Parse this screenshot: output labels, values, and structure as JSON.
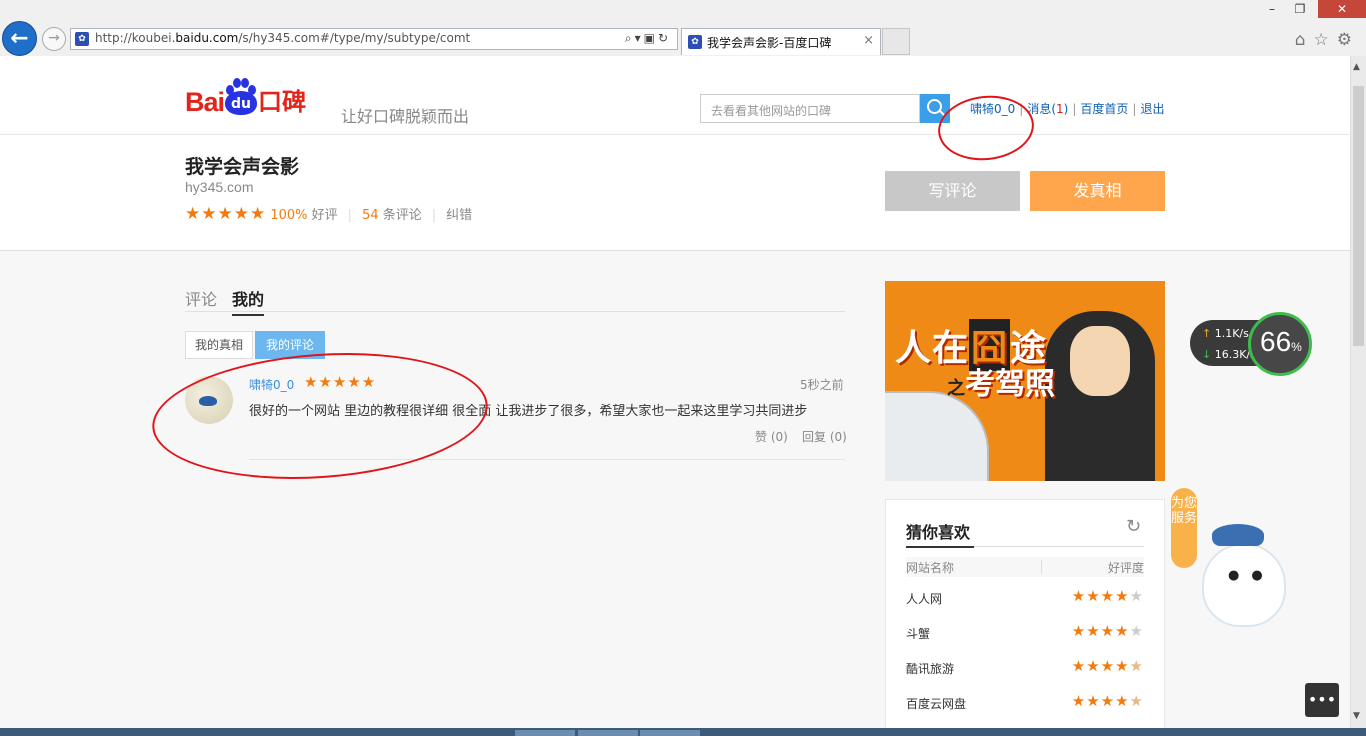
{
  "browser": {
    "back_icon": "back-arrow-icon",
    "forward_icon": "forward-arrow-icon",
    "url_prefix": "http://koubei.",
    "url_host": "baidu.com",
    "url_suffix": "/s/hy345.com#/type/my/subtype/comt",
    "tab_title": "我学会声会影-百度口碑",
    "tab_close": "×"
  },
  "header": {
    "logo_bai": "Bai",
    "logo_du": "du",
    "logo_kb": "口碑",
    "slogan": "让好口碑脱颖而出",
    "search_placeholder": "去看看其他网站的口碑",
    "user": "啸犄0_0",
    "messages_label": "消息(",
    "messages_count": "1",
    "messages_close": ")",
    "home_link": "百度首页",
    "logout": "退出"
  },
  "site": {
    "name": "我学会声会影",
    "domain": "hy345.com",
    "stars": "★★★★★",
    "good_pct": "100%",
    "good_label": "好评",
    "review_count": "54",
    "review_label": "条评论",
    "correct": "纠错",
    "write_btn": "写评论",
    "truth_btn": "发真相"
  },
  "tabs": {
    "comment": "评论",
    "mine": "我的"
  },
  "subtabs": {
    "truth": "我的真相",
    "comment": "我的评论"
  },
  "comment": {
    "user": "啸犄0_0",
    "rating": 5,
    "stars": "★★★★★",
    "time": "5秒之前",
    "text": "很好的一个网站 里边的教程很详细 很全面  让我进步了很多，希望大家也一起来这里学习共同进步",
    "like": "赞 (0)",
    "reply": "回复 (0)"
  },
  "ad": {
    "line1_a": "人在",
    "line1_b": "囧",
    "line1_c": "途",
    "line2_small": "之",
    "line2": "考驾照"
  },
  "guess": {
    "title": "猜你喜欢",
    "col_name": "网站名称",
    "col_rate": "好评度",
    "rows": [
      {
        "name": "人人网",
        "rating": 4,
        "on": "★★★★",
        "off": "★"
      },
      {
        "name": "斗蟹",
        "rating": 4,
        "on": "★★★★",
        "off": "★"
      },
      {
        "name": "酷讯旅游",
        "rating": 4.5,
        "on": "★★★★",
        "off": "★"
      },
      {
        "name": "百度云网盘",
        "rating": 4.5,
        "on": "★★★★",
        "off": "★"
      }
    ]
  },
  "speed": {
    "up": "1.1",
    "up_unit": "K/s",
    "down": "16.3",
    "down_unit": "K/s",
    "percent": "66",
    "percent_unit": "%"
  },
  "mascot": {
    "tag": "为您服务"
  },
  "colors": {
    "accent_orange": "#f37a0e",
    "link_blue": "#0f5fb3",
    "baidu_red": "#e1251b",
    "baidu_blue": "#2932e1",
    "annotation_red": "#e0151a"
  }
}
